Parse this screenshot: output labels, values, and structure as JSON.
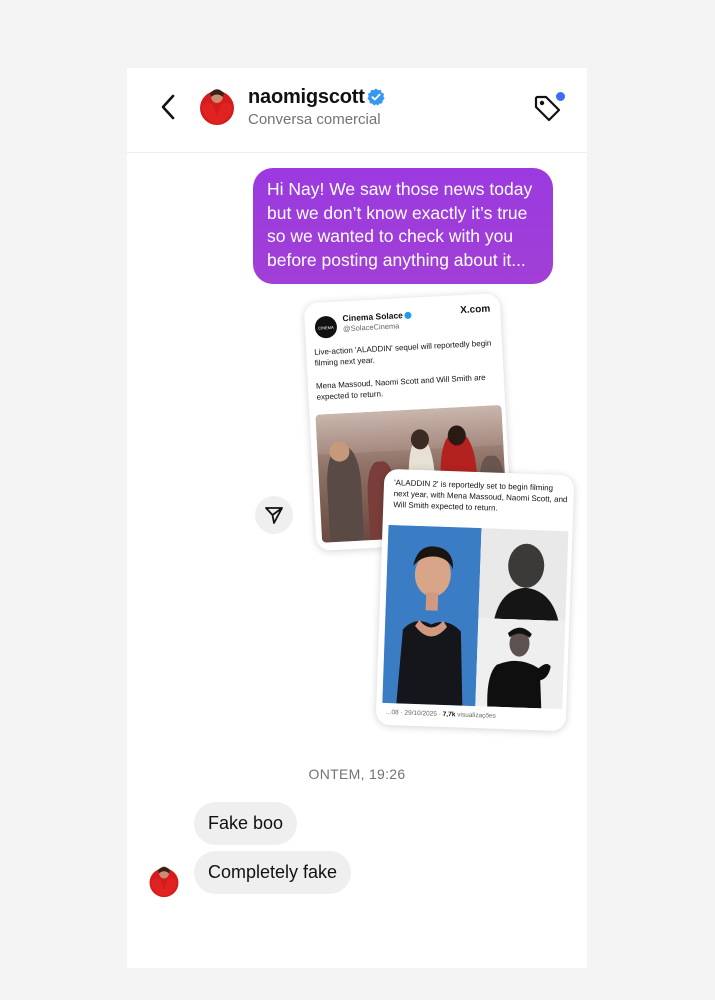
{
  "header": {
    "username": "naomigscott",
    "subtitle": "Conversa comercial",
    "verified": true,
    "tag_dot_color": "#3b6cf6"
  },
  "messages": {
    "outgoing_text": "Hi Nay! We saw those news today but we don’t know exactly it’s true so we wanted to check with you before posting anything about it...",
    "bubble_color": "#a13fd6"
  },
  "shared_post": {
    "card1": {
      "account_name": "Cinema Solace",
      "handle": "@SolaceCinema",
      "site": "X.com",
      "text_1": "Live-action 'ALADDIN' sequel will reportedly begin filming next year.",
      "text_2": "Mena Massoud, Naomi Scott and Will Smith are expected to return."
    },
    "card2": {
      "text": "'ALADDIN 2' is reportedly set to begin filming next year, with Mena Massoud, Naomi Scott, and Will Smith expected to return.",
      "footer_date": "...08 · 29/10/2025",
      "footer_views": "7,7k",
      "footer_views_label": "visualizações"
    }
  },
  "timestamp": "ONTEM, 19:26",
  "replies": [
    {
      "text": "Fake boo"
    },
    {
      "text": "Completely fake"
    }
  ],
  "icons": {
    "back": "chevron-left-icon",
    "verified": "verified-badge-icon",
    "tag": "tag-icon",
    "share": "send-icon"
  }
}
